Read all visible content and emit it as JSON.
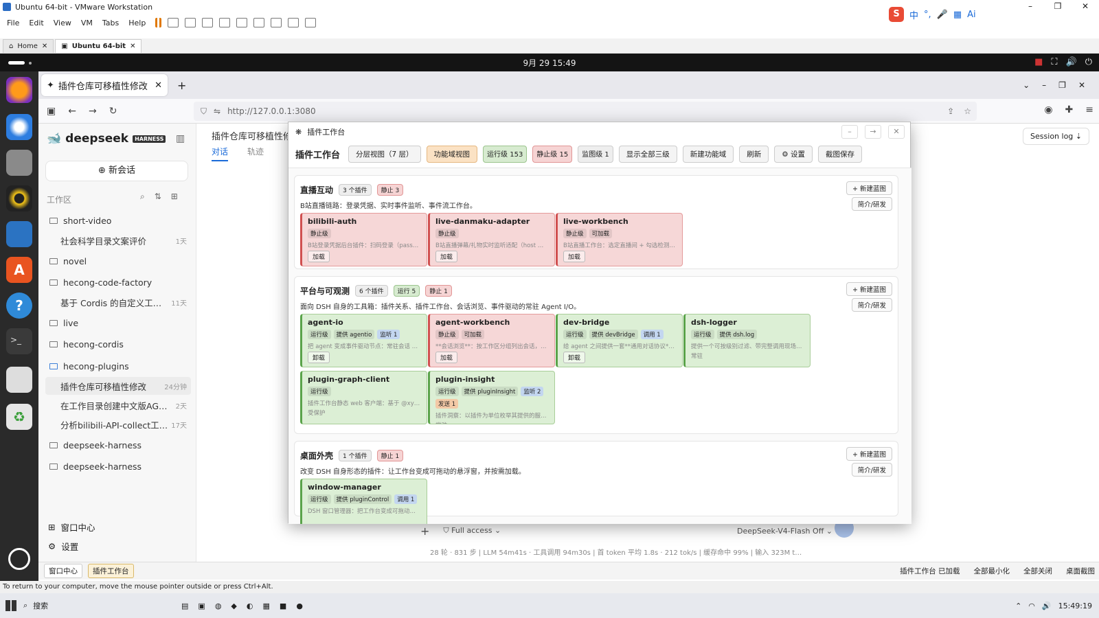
{
  "vmware": {
    "title": "Ubuntu 64-bit - VMware Workstation",
    "menu": [
      "File",
      "Edit",
      "View",
      "VM",
      "Tabs",
      "Help"
    ],
    "tabs": [
      {
        "label": "Home"
      },
      {
        "label": "Ubuntu 64-bit"
      }
    ],
    "status_text": "To return to your computer, move the mouse pointer outside or press Ctrl+Alt."
  },
  "ime": {
    "items": [
      "中",
      "°,",
      "🎤",
      "▦",
      "Ai"
    ]
  },
  "ubuntu": {
    "clock": "9月 29  15:49"
  },
  "firefox": {
    "tab_title": "插件仓库可移植性修改 —",
    "url": "http://127.0.0.1:3080"
  },
  "app": {
    "brand": "deepseek",
    "brand_badge": "HARNESS",
    "new_chat": "⊕ 新会话",
    "workspace_label": "工作区",
    "workspace_items": [
      {
        "name": "short-video",
        "time": "",
        "child": false
      },
      {
        "name": "社会科学目录文案评价",
        "time": "1天",
        "child": true
      },
      {
        "name": "novel",
        "time": "",
        "child": false
      },
      {
        "name": "hecong-code-factory",
        "time": "",
        "child": false
      },
      {
        "name": "基于 Cordis 的自定义工程界…",
        "time": "11天",
        "child": true
      },
      {
        "name": "live",
        "time": "",
        "child": false
      },
      {
        "name": "hecong-cordis",
        "time": "",
        "child": false
      },
      {
        "name": "hecong-plugins",
        "time": "",
        "child": false
      },
      {
        "name": "插件仓库可移植性修改",
        "time": "24分钟",
        "child": true
      },
      {
        "name": "在工作目录创建中文版AGENT…",
        "time": "2天",
        "child": true
      },
      {
        "name": "分析bilibili-API-collect工程…",
        "time": "17天",
        "child": true
      },
      {
        "name": "deepseek-harness",
        "time": "",
        "child": false
      },
      {
        "name": "deepseek-harness",
        "time": "",
        "child": false
      }
    ],
    "window_center": "窗口中心",
    "settings": "设置",
    "page_title": "插件仓库可移植性修",
    "page_tabs": [
      "对话",
      "轨迹"
    ],
    "session_log": "Session log ⇣",
    "composer": {
      "plus": "+",
      "access": "Full access",
      "model": "DeepSeek-V4-Flash",
      "model_state": "Off"
    },
    "stats": "28 轮 · 831 步   |   LLM 54m41s · 工具调用 94m30s   |   首 token 平均 1.8s · 212 tok/s   |   缓存命中 99%   |   输入 323M t…",
    "strip": {
      "left": [
        "窗口中心",
        "插件工作台"
      ],
      "right": [
        "插件工作台 已加载",
        "全部最小化",
        "全部关闭",
        "桌面截图"
      ]
    }
  },
  "workbench": {
    "window_title": "插件工作台",
    "toolbar_title": "插件工作台",
    "toolbar": [
      {
        "label": "分层视图（7 层）",
        "style": "normal"
      },
      {
        "label": "功能域视图",
        "style": "hl"
      },
      {
        "label": "运行级 153",
        "style": "g"
      },
      {
        "label": "静止级 15",
        "style": "r"
      },
      {
        "label": "监图级 1",
        "style": "n"
      },
      {
        "label": "显示全部三级",
        "style": "normal"
      },
      {
        "label": "新建功能域",
        "style": "normal"
      },
      {
        "label": "刷新",
        "style": "normal"
      },
      {
        "label": "⚙ 设置",
        "style": "normal"
      },
      {
        "label": "截图保存",
        "style": "normal"
      }
    ],
    "new_blueprint": "+ 新建蓝图",
    "intro_btn": "简介/研发",
    "domains": [
      {
        "title": "直播互动",
        "badges": [
          "3 个插件",
          "静止 3"
        ],
        "desc": "B站直播链路：登录凭据、实时事件监听、事件流工作台。",
        "cards": [
          {
            "name": "bilibili-auth",
            "color": "red",
            "tags": [
              "静止级"
            ],
            "desc": "B站登录凭据后台插件：扫码登录（passpo…",
            "action": "加载"
          },
          {
            "name": "live-danmaku-adapter",
            "color": "red",
            "tags": [
              "静止级"
            ],
            "desc": "B站直播弹幕/礼物实时监听适配（host 插…",
            "action": "加载"
          },
          {
            "name": "live-workbench",
            "color": "red",
            "tags": [
              "静止级",
              "可加载"
            ],
            "desc": "B站直播工作台：选定直播间 + 勾选检测目…",
            "action": "加载"
          }
        ]
      },
      {
        "title": "平台与可观测",
        "badges": [
          "6 个插件",
          "运行 5",
          "静止 1"
        ],
        "desc": "面向 DSH 自身的工具箱：插件关系、插件工作台、会话浏览、事件驱动的常驻 Agent I/O。",
        "cards": [
          {
            "name": "agent-io",
            "color": "green",
            "tags": [
              "运行级",
              "提供 agentio",
              "监听 1"
            ],
            "desc": "把 agent 变成事件驱动节点：常驻会话 +…",
            "action": "卸载"
          },
          {
            "name": "agent-workbench",
            "color": "red",
            "tags": [
              "静止级",
              "可加载"
            ],
            "desc": "**会话浏览**：按工作区分组列出会话，…",
            "action": "加载"
          },
          {
            "name": "dev-bridge",
            "color": "green",
            "tags": [
              "运行级",
              "提供 devBridge",
              "调用 1"
            ],
            "desc": "给 agent 之间提供一套**通用对话协议**（…",
            "action": "卸载"
          },
          {
            "name": "dsh-logger",
            "color": "green",
            "tags": [
              "运行级",
              "提供 dsh.log"
            ],
            "desc": "提供一个可按级别过滤、带完整调用现场（…",
            "desc2": "常驻",
            "action": ""
          },
          {
            "name": "plugin-graph-client",
            "color": "green",
            "tags": [
              "运行级"
            ],
            "desc": "插件工作台静态 web 客户端：基于 @xyflo…",
            "desc2": "受保护",
            "action": ""
          },
          {
            "name": "plugin-insight",
            "color": "green",
            "tags": [
              "运行级",
              "提供 pluginInsight",
              "监听 2"
            ],
            "extra": "发送 1",
            "desc": "插件洞察：以插件为单位枚举其提供的服务…",
            "desc2": "常驻",
            "action": ""
          }
        ]
      },
      {
        "title": "桌面外壳",
        "badges": [
          "1 个插件",
          "静止 1"
        ],
        "desc": "改变 DSH 自身形态的插件：让工作台变成可拖动的悬浮窗，并按需加载。",
        "cards": [
          {
            "name": "window-manager",
            "color": "green",
            "tags": [
              "运行级",
              "提供 pluginControl",
              "调用 1"
            ],
            "desc": "DSH 窗口管理器：把工作台变成可拖动…",
            "action": ""
          }
        ]
      }
    ]
  },
  "taskbar": {
    "search": "搜索",
    "time": "15:49:19"
  }
}
